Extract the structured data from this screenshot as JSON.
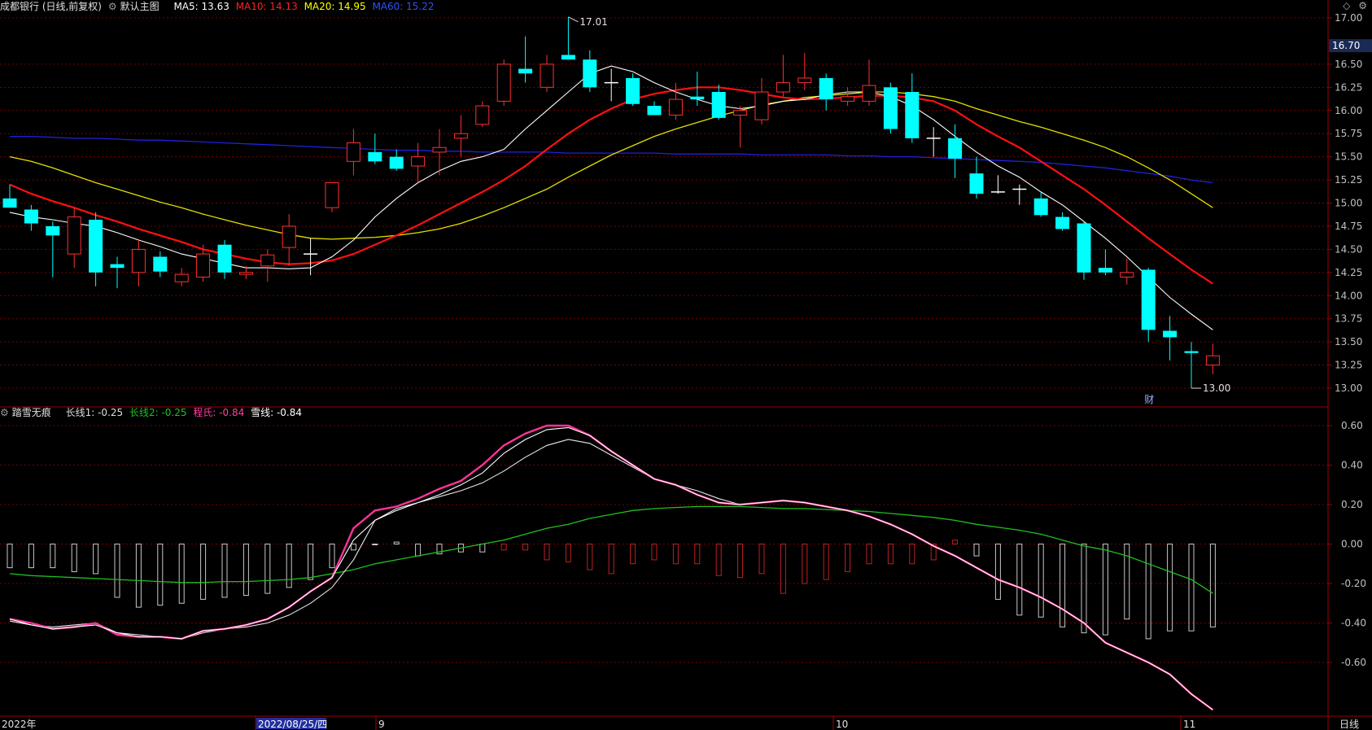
{
  "header": {
    "title": "成都银行 (日线,前复权)",
    "template": "默认主图",
    "ma": [
      {
        "label": "MA5: 13.63",
        "color": "#ffffff"
      },
      {
        "label": "MA10: 14.13",
        "color": "#ff2020"
      },
      {
        "label": "MA20: 14.95",
        "color": "#ffff00"
      },
      {
        "label": "MA60: 15.22",
        "color": "#3050ff"
      }
    ]
  },
  "window_controls": [
    "◇",
    "⚙"
  ],
  "sub_header": {
    "title": "踏雪无痕",
    "items": [
      {
        "label": "长线1: -0.25",
        "color": "#dddddd"
      },
      {
        "label": "长线2: -0.25",
        "color": "#20c020"
      },
      {
        "label": "程氏: -0.84",
        "color": "#ff40a0"
      },
      {
        "label": "雪线: -0.84",
        "color": "#ffffff"
      }
    ]
  },
  "price_axis": {
    "ticks": [
      "17.00",
      "16.70",
      "16.50",
      "16.25",
      "16.00",
      "15.75",
      "15.50",
      "15.25",
      "15.00",
      "14.75",
      "14.50",
      "14.25",
      "14.00",
      "13.75",
      "13.50",
      "13.25",
      "13.00"
    ],
    "current": "16.70"
  },
  "indicator_axis": {
    "ticks": [
      "0.60",
      "0.40",
      "0.20",
      "0.00",
      "-0.20",
      "-0.40",
      "-0.60"
    ]
  },
  "annotations": {
    "high": "17.01",
    "low": "13.00",
    "cai": "财"
  },
  "time_axis": {
    "labels": [
      "2022年",
      "2022/08/25/四",
      "9",
      "10",
      "11"
    ],
    "period": "日线"
  },
  "colors": {
    "up": "#ff3030",
    "down": "#00ffff",
    "grid": "#7a0000",
    "ma5": "#ffffff",
    "ma10": "#ff1010",
    "ma20": "#e0e000",
    "ma60": "#2020e0",
    "long1": "#ffffff",
    "long2": "#20c020",
    "chengshi": "#ff3399",
    "xuexian": "#ffffff"
  },
  "chart_data": [
    {
      "type": "candlestick",
      "title": "成都银行 (日线,前复权)",
      "ylim": [
        12.82,
        17.05
      ],
      "candles": [
        {
          "o": 15.05,
          "h": 15.2,
          "l": 14.95,
          "c": 14.95
        },
        {
          "o": 14.93,
          "h": 14.98,
          "l": 14.7,
          "c": 14.78
        },
        {
          "o": 14.75,
          "h": 14.8,
          "l": 14.2,
          "c": 14.65
        },
        {
          "o": 14.45,
          "h": 14.95,
          "l": 14.3,
          "c": 14.85
        },
        {
          "o": 14.82,
          "h": 14.9,
          "l": 14.1,
          "c": 14.25
        },
        {
          "o": 14.34,
          "h": 14.42,
          "l": 14.08,
          "c": 14.3
        },
        {
          "o": 14.25,
          "h": 14.6,
          "l": 14.1,
          "c": 14.5
        },
        {
          "o": 14.42,
          "h": 14.48,
          "l": 14.2,
          "c": 14.26
        },
        {
          "o": 14.15,
          "h": 14.3,
          "l": 14.1,
          "c": 14.23
        },
        {
          "o": 14.2,
          "h": 14.55,
          "l": 14.15,
          "c": 14.45
        },
        {
          "o": 14.55,
          "h": 14.6,
          "l": 14.18,
          "c": 14.25
        },
        {
          "o": 14.23,
          "h": 14.32,
          "l": 14.18,
          "c": 14.25
        },
        {
          "o": 14.32,
          "h": 14.5,
          "l": 14.15,
          "c": 14.44
        },
        {
          "o": 14.52,
          "h": 14.88,
          "l": 14.32,
          "c": 14.75
        },
        {
          "o": 14.45,
          "h": 14.62,
          "l": 14.22,
          "c": 14.45
        },
        {
          "o": 14.95,
          "h": 15.2,
          "l": 14.9,
          "c": 15.22
        },
        {
          "o": 15.45,
          "h": 15.8,
          "l": 15.3,
          "c": 15.65
        },
        {
          "o": 15.55,
          "h": 15.75,
          "l": 15.42,
          "c": 15.45
        },
        {
          "o": 15.5,
          "h": 15.58,
          "l": 15.35,
          "c": 15.37
        },
        {
          "o": 15.4,
          "h": 15.65,
          "l": 15.22,
          "c": 15.5
        },
        {
          "o": 15.55,
          "h": 15.8,
          "l": 15.3,
          "c": 15.6
        },
        {
          "o": 15.7,
          "h": 15.95,
          "l": 15.5,
          "c": 15.75
        },
        {
          "o": 15.85,
          "h": 16.1,
          "l": 15.82,
          "c": 16.05
        },
        {
          "o": 16.1,
          "h": 16.55,
          "l": 16.05,
          "c": 16.5
        },
        {
          "o": 16.45,
          "h": 16.8,
          "l": 16.3,
          "c": 16.4
        },
        {
          "o": 16.25,
          "h": 16.6,
          "l": 16.2,
          "c": 16.5
        },
        {
          "o": 16.6,
          "h": 17.01,
          "l": 16.55,
          "c": 16.55
        },
        {
          "o": 16.55,
          "h": 16.65,
          "l": 16.2,
          "c": 16.25
        },
        {
          "o": 16.3,
          "h": 16.45,
          "l": 16.1,
          "c": 16.3
        },
        {
          "o": 16.35,
          "h": 16.4,
          "l": 16.05,
          "c": 16.07
        },
        {
          "o": 16.05,
          "h": 16.1,
          "l": 15.95,
          "c": 15.95
        },
        {
          "o": 15.95,
          "h": 16.3,
          "l": 15.9,
          "c": 16.12
        },
        {
          "o": 16.15,
          "h": 16.42,
          "l": 16.05,
          "c": 16.12
        },
        {
          "o": 16.2,
          "h": 16.28,
          "l": 15.9,
          "c": 15.92
        },
        {
          "o": 15.95,
          "h": 16.05,
          "l": 15.6,
          "c": 16.0
        },
        {
          "o": 15.9,
          "h": 16.35,
          "l": 15.85,
          "c": 16.2
        },
        {
          "o": 16.2,
          "h": 16.6,
          "l": 16.15,
          "c": 16.3
        },
        {
          "o": 16.3,
          "h": 16.62,
          "l": 16.22,
          "c": 16.35
        },
        {
          "o": 16.35,
          "h": 16.4,
          "l": 16.0,
          "c": 16.12
        },
        {
          "o": 16.1,
          "h": 16.25,
          "l": 16.05,
          "c": 16.15
        },
        {
          "o": 16.1,
          "h": 16.55,
          "l": 16.05,
          "c": 16.27
        },
        {
          "o": 16.25,
          "h": 16.3,
          "l": 15.75,
          "c": 15.8
        },
        {
          "o": 16.2,
          "h": 16.4,
          "l": 15.65,
          "c": 15.7
        },
        {
          "o": 15.7,
          "h": 15.82,
          "l": 15.5,
          "c": 15.7
        },
        {
          "o": 15.7,
          "h": 15.85,
          "l": 15.27,
          "c": 15.48
        },
        {
          "o": 15.32,
          "h": 15.5,
          "l": 15.05,
          "c": 15.1
        },
        {
          "o": 15.12,
          "h": 15.3,
          "l": 15.1,
          "c": 15.12
        },
        {
          "o": 15.15,
          "h": 15.2,
          "l": 14.98,
          "c": 15.14
        },
        {
          "o": 15.05,
          "h": 15.12,
          "l": 14.85,
          "c": 14.87
        },
        {
          "o": 14.85,
          "h": 14.9,
          "l": 14.7,
          "c": 14.72
        },
        {
          "o": 14.78,
          "h": 14.8,
          "l": 14.17,
          "c": 14.25
        },
        {
          "o": 14.3,
          "h": 14.5,
          "l": 14.22,
          "c": 14.25
        },
        {
          "o": 14.2,
          "h": 14.4,
          "l": 14.12,
          "c": 14.25
        },
        {
          "o": 14.28,
          "h": 14.3,
          "l": 13.5,
          "c": 13.63
        },
        {
          "o": 13.62,
          "h": 13.78,
          "l": 13.3,
          "c": 13.55
        },
        {
          "o": 13.4,
          "h": 13.5,
          "l": 13.0,
          "c": 13.38
        },
        {
          "o": 13.25,
          "h": 13.48,
          "l": 13.15,
          "c": 13.35
        }
      ],
      "ma5": [
        14.9,
        14.85,
        14.82,
        14.78,
        14.75,
        14.68,
        14.6,
        14.53,
        14.45,
        14.4,
        14.35,
        14.3,
        14.3,
        14.29,
        14.3,
        14.42,
        14.6,
        14.85,
        15.05,
        15.22,
        15.35,
        15.45,
        15.5,
        15.58,
        15.8,
        16.0,
        16.2,
        16.4,
        16.48,
        16.42,
        16.3,
        16.2,
        16.12,
        16.05,
        16.02,
        16.05,
        16.1,
        16.12,
        16.17,
        16.2,
        16.2,
        16.15,
        16.05,
        15.9,
        15.72,
        15.55,
        15.4,
        15.28,
        15.12,
        14.98,
        14.8,
        14.62,
        14.42,
        14.2,
        13.98,
        13.8,
        13.63
      ],
      "ma10": [
        15.2,
        15.1,
        15.02,
        14.95,
        14.87,
        14.8,
        14.72,
        14.65,
        14.58,
        14.5,
        14.45,
        14.4,
        14.36,
        14.34,
        14.35,
        14.38,
        14.45,
        14.55,
        14.65,
        14.76,
        14.88,
        15.0,
        15.12,
        15.25,
        15.4,
        15.58,
        15.75,
        15.9,
        16.02,
        16.12,
        16.18,
        16.22,
        16.25,
        16.25,
        16.22,
        16.18,
        16.14,
        16.12,
        16.13,
        16.14,
        16.16,
        16.16,
        16.14,
        16.1,
        16.0,
        15.85,
        15.72,
        15.6,
        15.45,
        15.3,
        15.15,
        14.98,
        14.8,
        14.62,
        14.45,
        14.28,
        14.13
      ],
      "ma20": [
        15.5,
        15.45,
        15.38,
        15.3,
        15.22,
        15.15,
        15.08,
        15.01,
        14.95,
        14.88,
        14.82,
        14.76,
        14.71,
        14.66,
        14.62,
        14.61,
        14.62,
        14.63,
        14.65,
        14.68,
        14.72,
        14.78,
        14.86,
        14.95,
        15.05,
        15.15,
        15.28,
        15.4,
        15.52,
        15.62,
        15.72,
        15.8,
        15.87,
        15.94,
        16.0,
        16.06,
        16.1,
        16.14,
        16.16,
        16.18,
        16.2,
        16.2,
        16.18,
        16.15,
        16.1,
        16.02,
        15.95,
        15.88,
        15.82,
        15.75,
        15.68,
        15.6,
        15.5,
        15.38,
        15.25,
        15.1,
        14.95
      ],
      "ma60": [
        15.72,
        15.72,
        15.71,
        15.7,
        15.7,
        15.69,
        15.68,
        15.68,
        15.67,
        15.66,
        15.65,
        15.64,
        15.63,
        15.62,
        15.61,
        15.6,
        15.59,
        15.58,
        15.57,
        15.57,
        15.56,
        15.56,
        15.55,
        15.55,
        15.55,
        15.55,
        15.54,
        15.54,
        15.54,
        15.54,
        15.54,
        15.53,
        15.53,
        15.53,
        15.53,
        15.52,
        15.52,
        15.52,
        15.52,
        15.51,
        15.51,
        15.5,
        15.5,
        15.49,
        15.48,
        15.47,
        15.46,
        15.45,
        15.44,
        15.42,
        15.4,
        15.38,
        15.35,
        15.32,
        15.29,
        15.25,
        15.22
      ]
    },
    {
      "type": "line",
      "title": "踏雪无痕",
      "ylim": [
        -0.84,
        0.62
      ],
      "series": [
        {
          "name": "长线1",
          "values": [
            -0.39,
            -0.41,
            -0.42,
            -0.41,
            -0.4,
            -0.45,
            -0.46,
            -0.47,
            -0.48,
            -0.45,
            -0.43,
            -0.42,
            -0.4,
            -0.36,
            -0.3,
            -0.22,
            -0.08,
            0.12,
            0.18,
            0.21,
            0.24,
            0.27,
            0.31,
            0.37,
            0.44,
            0.5,
            0.53,
            0.51,
            0.45,
            0.39,
            0.33,
            0.3,
            0.27,
            0.23,
            0.2,
            0.21,
            0.22,
            0.21,
            0.19,
            0.17,
            0.14,
            0.1,
            0.05,
            -0.01,
            -0.06,
            -0.12,
            -0.18,
            -0.22,
            -0.27,
            -0.33,
            -0.4,
            -0.5,
            -0.55,
            -0.6,
            -0.66,
            -0.76,
            -0.84
          ]
        },
        {
          "name": "长线2",
          "values": [
            -0.15,
            -0.16,
            -0.165,
            -0.17,
            -0.175,
            -0.18,
            -0.185,
            -0.19,
            -0.195,
            -0.195,
            -0.19,
            -0.19,
            -0.185,
            -0.18,
            -0.17,
            -0.15,
            -0.13,
            -0.1,
            -0.08,
            -0.06,
            -0.04,
            -0.02,
            0.0,
            0.02,
            0.05,
            0.08,
            0.1,
            0.13,
            0.15,
            0.17,
            0.18,
            0.185,
            0.19,
            0.19,
            0.19,
            0.185,
            0.18,
            0.18,
            0.175,
            0.17,
            0.165,
            0.155,
            0.145,
            0.135,
            0.12,
            0.1,
            0.085,
            0.07,
            0.05,
            0.02,
            -0.01,
            -0.03,
            -0.06,
            -0.1,
            -0.14,
            -0.18,
            -0.25
          ]
        },
        {
          "name": "程氏",
          "values": [
            -0.38,
            -0.4,
            -0.43,
            -0.42,
            -0.4,
            -0.46,
            -0.47,
            -0.47,
            -0.48,
            -0.44,
            -0.43,
            -0.41,
            -0.38,
            -0.32,
            -0.24,
            -0.17,
            0.08,
            0.17,
            0.19,
            0.23,
            0.28,
            0.32,
            0.4,
            0.5,
            0.56,
            0.6,
            0.6,
            0.55,
            0.47,
            0.4,
            0.33,
            0.3,
            0.25,
            0.21,
            0.2,
            0.21,
            0.22,
            0.21,
            0.19,
            0.17,
            0.14,
            0.1,
            0.05,
            -0.01,
            -0.06,
            -0.12,
            -0.18,
            -0.22,
            -0.27,
            -0.33,
            -0.4,
            -0.5,
            -0.55,
            -0.6,
            -0.66,
            -0.76,
            -0.84
          ]
        },
        {
          "name": "雪线",
          "values": [
            -0.38,
            -0.41,
            -0.43,
            -0.42,
            -0.41,
            -0.45,
            -0.47,
            -0.47,
            -0.48,
            -0.44,
            -0.43,
            -0.41,
            -0.38,
            -0.32,
            -0.24,
            -0.17,
            0.02,
            0.12,
            0.17,
            0.21,
            0.25,
            0.3,
            0.36,
            0.46,
            0.53,
            0.58,
            0.59,
            0.55,
            0.47,
            0.4,
            0.33,
            0.3,
            0.25,
            0.21,
            0.2,
            0.21,
            0.22,
            0.21,
            0.19,
            0.17,
            0.14,
            0.1,
            0.05,
            -0.01,
            -0.06,
            -0.12,
            -0.18,
            -0.22,
            -0.27,
            -0.33,
            -0.4,
            -0.5,
            -0.55,
            -0.6,
            -0.66,
            -0.76,
            -0.84
          ]
        }
      ],
      "bars": [
        -0.12,
        -0.12,
        -0.12,
        -0.14,
        -0.15,
        -0.27,
        -0.32,
        -0.31,
        -0.3,
        -0.28,
        -0.27,
        -0.26,
        -0.25,
        -0.22,
        -0.18,
        -0.12,
        -0.03,
        0.0,
        0.01,
        -0.06,
        -0.05,
        -0.04,
        -0.04,
        -0.03,
        -0.03,
        -0.08,
        -0.09,
        -0.13,
        -0.15,
        -0.1,
        -0.08,
        -0.1,
        -0.1,
        -0.16,
        -0.17,
        -0.15,
        -0.25,
        -0.2,
        -0.18,
        -0.14,
        -0.1,
        -0.1,
        -0.1,
        -0.08,
        0.02,
        -0.06,
        -0.28,
        -0.36,
        -0.37,
        -0.42,
        -0.45,
        -0.46,
        -0.38,
        -0.48,
        -0.44,
        -0.44,
        -0.42
      ]
    }
  ]
}
